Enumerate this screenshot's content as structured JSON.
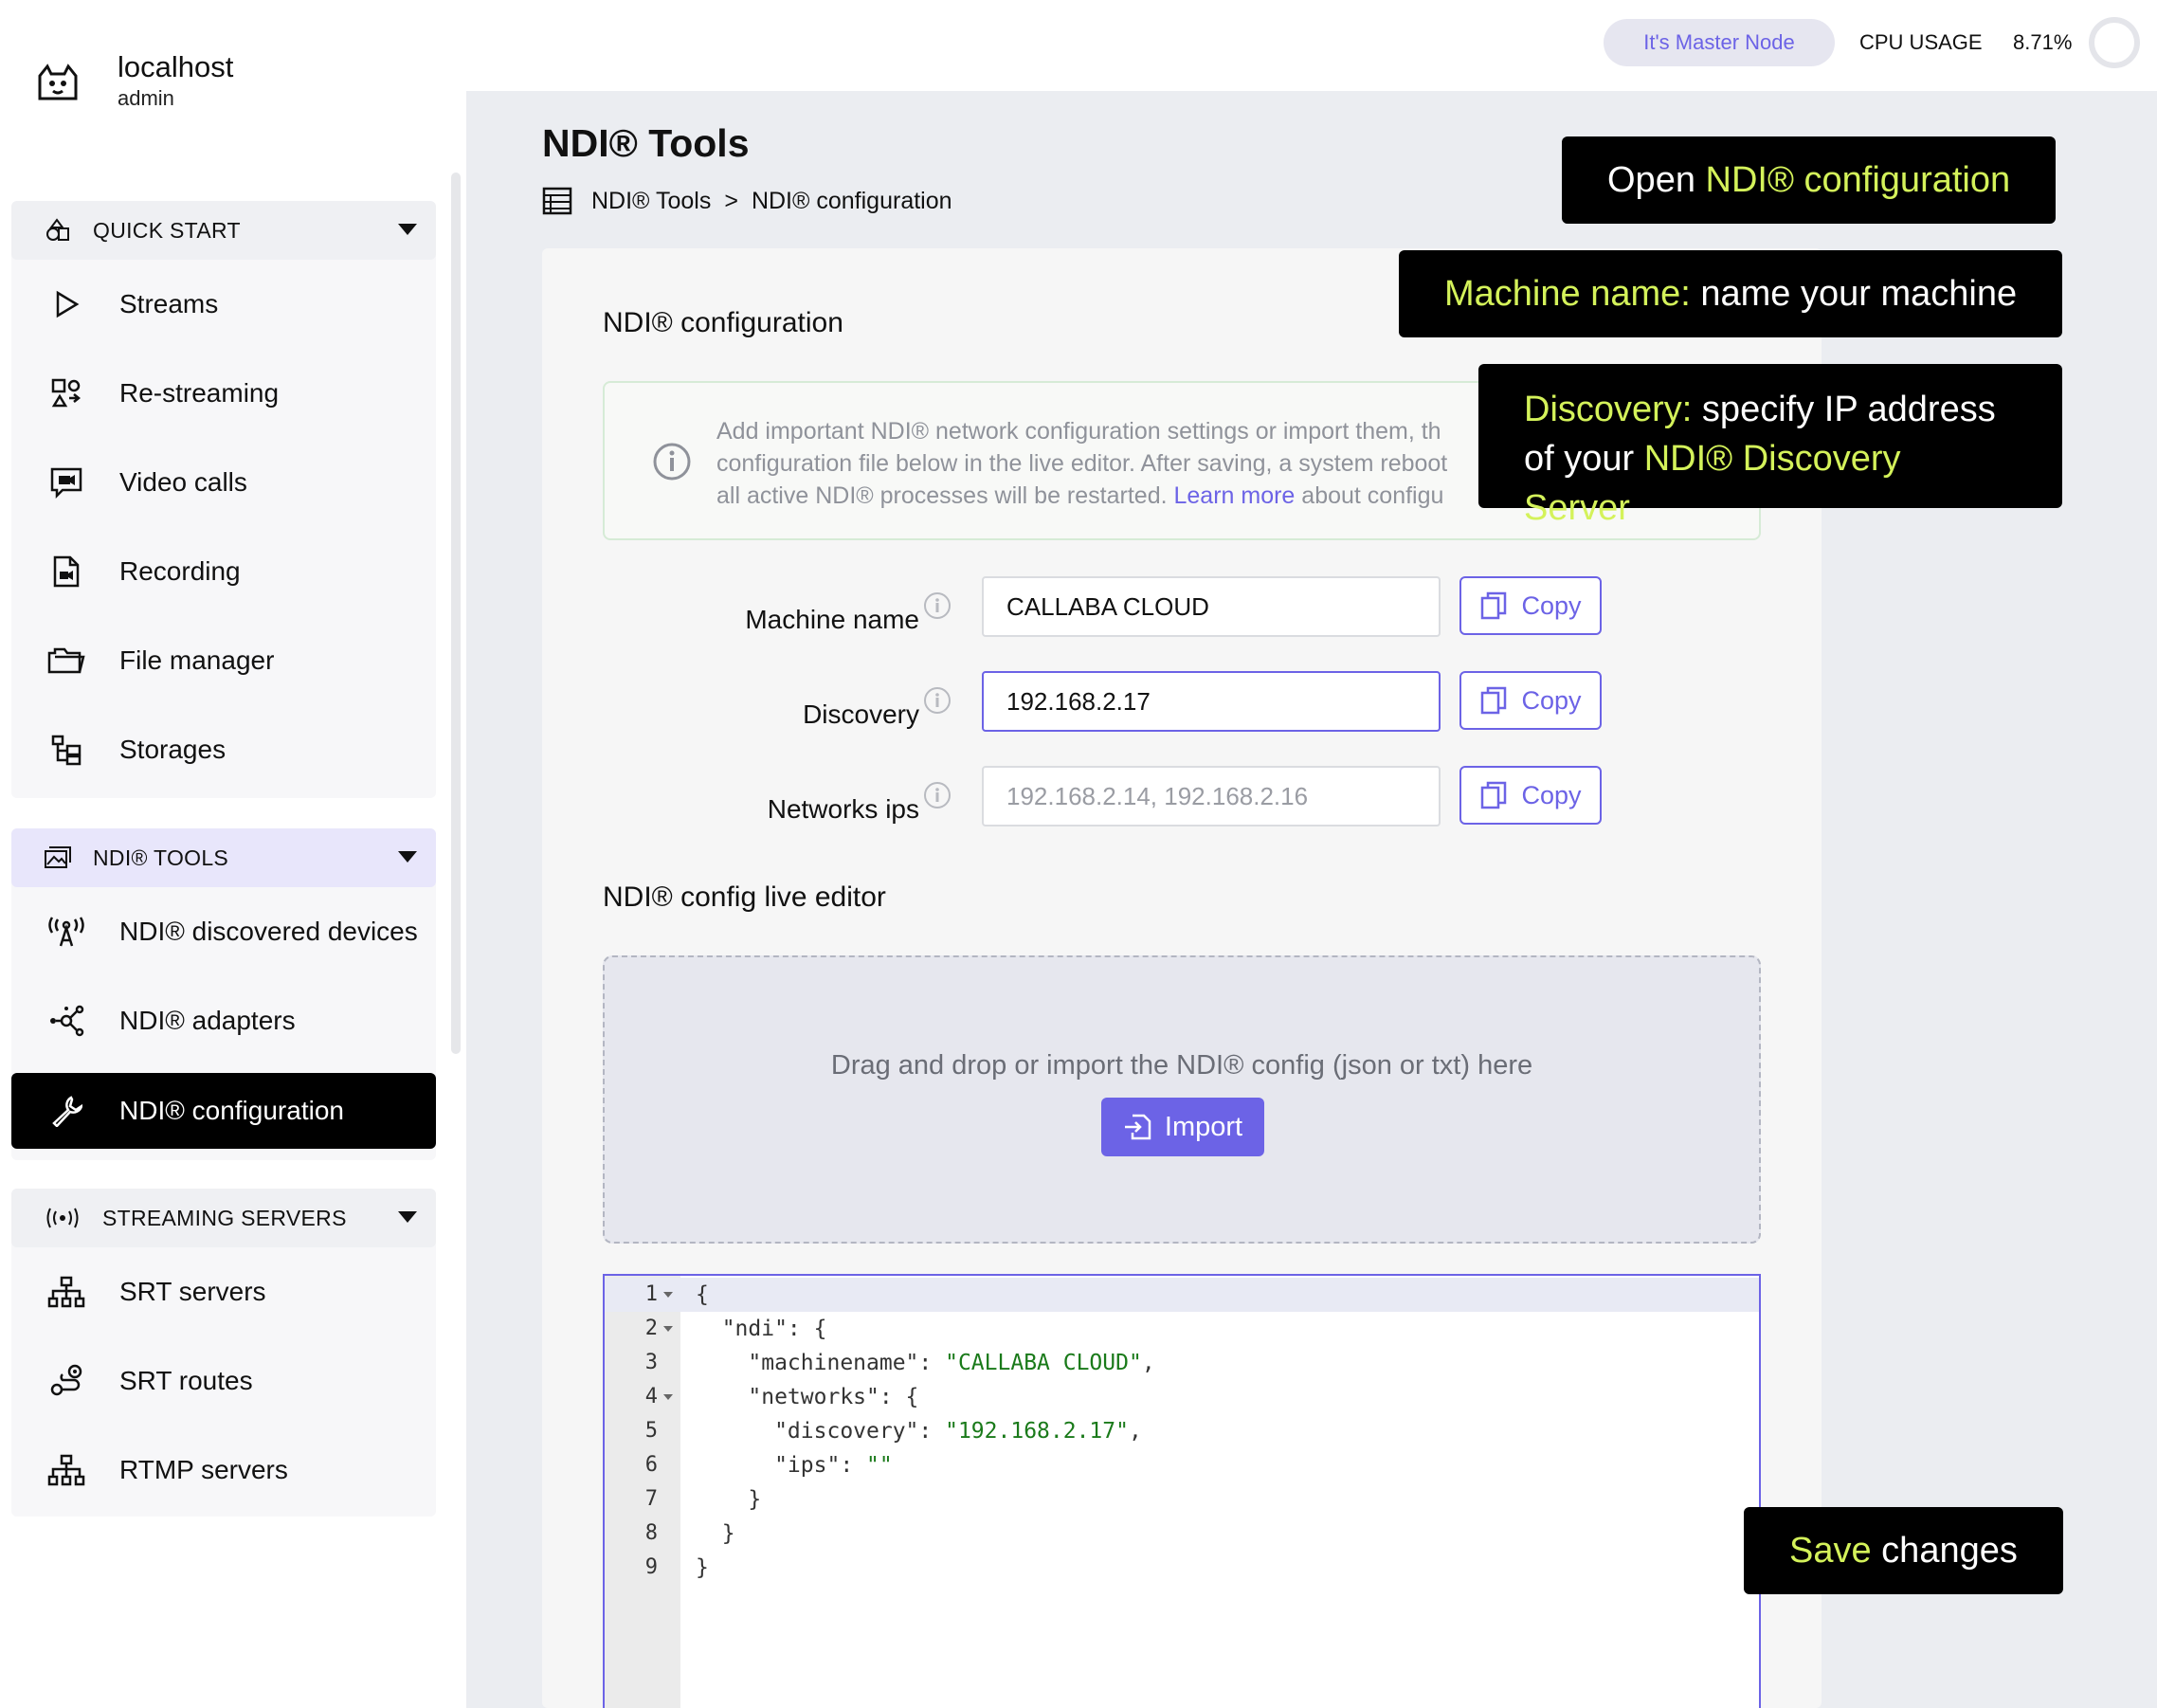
{
  "app": {
    "host": "localhost",
    "user": "admin"
  },
  "topbar": {
    "master_node": "It's Master Node",
    "cpu_label": "CPU USAGE",
    "cpu_value": "8.71%"
  },
  "sidebar": {
    "quick_start": {
      "label": "QUICK START",
      "items": [
        {
          "label": "Streams",
          "icon": "play-icon"
        },
        {
          "label": "Re-streaming",
          "icon": "restream-icon"
        },
        {
          "label": "Video calls",
          "icon": "video-chat-icon"
        },
        {
          "label": "Recording",
          "icon": "record-file-icon"
        },
        {
          "label": "File manager",
          "icon": "folder-icon"
        },
        {
          "label": "Storages",
          "icon": "storage-tree-icon"
        }
      ]
    },
    "ndi_tools": {
      "label": "NDI® TOOLS",
      "items": [
        {
          "label": "NDI® discovered devices",
          "icon": "antenna-icon"
        },
        {
          "label": "NDI® adapters",
          "icon": "network-nodes-icon"
        },
        {
          "label": "NDI® configuration",
          "icon": "wrench-icon"
        }
      ]
    },
    "streaming_servers": {
      "label": "STREAMING SERVERS",
      "items": [
        {
          "label": "SRT servers",
          "icon": "server-tree-icon"
        },
        {
          "label": "SRT routes",
          "icon": "route-icon"
        },
        {
          "label": "RTMP servers",
          "icon": "server-tree-icon"
        }
      ]
    }
  },
  "header": {
    "title": "NDI® Tools",
    "breadcrumb": [
      "NDI® Tools",
      ">",
      "NDI® configuration"
    ]
  },
  "main": {
    "card_title": "NDI® configuration",
    "info_line1": "Add important NDI® network configuration settings or import them, th",
    "info_line2": "configuration file below in the live editor. After saving, a system reboot",
    "info_line3_a": "all active NDI® processes will be restarted. ",
    "info_link": "Learn more",
    "info_line3_b": " about configu",
    "fields": {
      "machine_name": {
        "label": "Machine name",
        "value": "CALLABA CLOUD"
      },
      "discovery": {
        "label": "Discovery",
        "value": "192.168.2.17"
      },
      "network_ips": {
        "label": "Networks ips",
        "placeholder": "192.168.2.14, 192.168.2.16"
      }
    },
    "copy_label": "Copy",
    "editor_title": "NDI® config live editor",
    "dropzone_text": "Drag and drop or import the NDI® config (json or txt) here",
    "import_label": "Import",
    "code_lines": [
      {
        "n": "1",
        "text": "{"
      },
      {
        "n": "2",
        "text": "  \"ndi\": {"
      },
      {
        "n": "3",
        "key": "    \"machinename\": ",
        "val": "\"CALLABA CLOUD\"",
        "tail": ","
      },
      {
        "n": "4",
        "text": "    \"networks\": {"
      },
      {
        "n": "5",
        "key": "      \"discovery\": ",
        "val": "\"192.168.2.17\"",
        "tail": ","
      },
      {
        "n": "6",
        "key": "      \"ips\": ",
        "val": "\"\"",
        "tail": ""
      },
      {
        "n": "7",
        "text": "    }"
      },
      {
        "n": "8",
        "text": "  }"
      },
      {
        "n": "9",
        "text": "}"
      }
    ]
  },
  "callouts": {
    "open_a": "Open ",
    "open_b": "NDI® configuration",
    "machine_a": "Machine name:",
    "machine_b": " name your machine",
    "discovery_a": "Discovery:",
    "discovery_b": " specify IP address",
    "discovery_c": "of your ",
    "discovery_d": "NDI® Discovery Server",
    "save_a": "Save",
    "save_b": " changes"
  },
  "colors": {
    "accent": "#6c63e6",
    "highlight": "#d4f25a",
    "string": "#1a7a1a"
  }
}
